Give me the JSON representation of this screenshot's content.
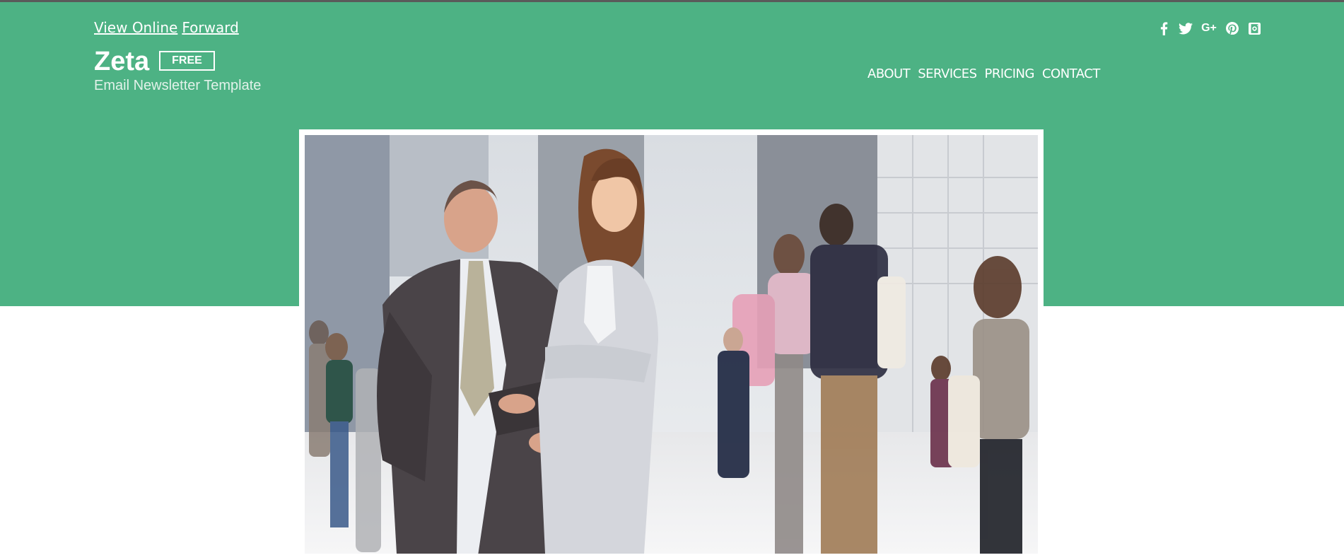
{
  "top_links": {
    "view_online": "View Online",
    "forward": "Forward"
  },
  "social_icons": [
    "facebook-icon",
    "twitter-icon",
    "google-plus-icon",
    "pinterest-icon",
    "instagram-icon"
  ],
  "social_labels": {
    "google_plus": "G+"
  },
  "brand": {
    "name": "Zeta",
    "badge": "FREE",
    "subtitle": "Email Newsletter Template"
  },
  "nav": {
    "items": [
      "ABOUT",
      "SERVICES",
      "PRICING",
      "CONTACT"
    ]
  },
  "colors": {
    "header_green": "#4db284",
    "top_strip": "#5a5a5a",
    "text_white": "#ffffff"
  }
}
